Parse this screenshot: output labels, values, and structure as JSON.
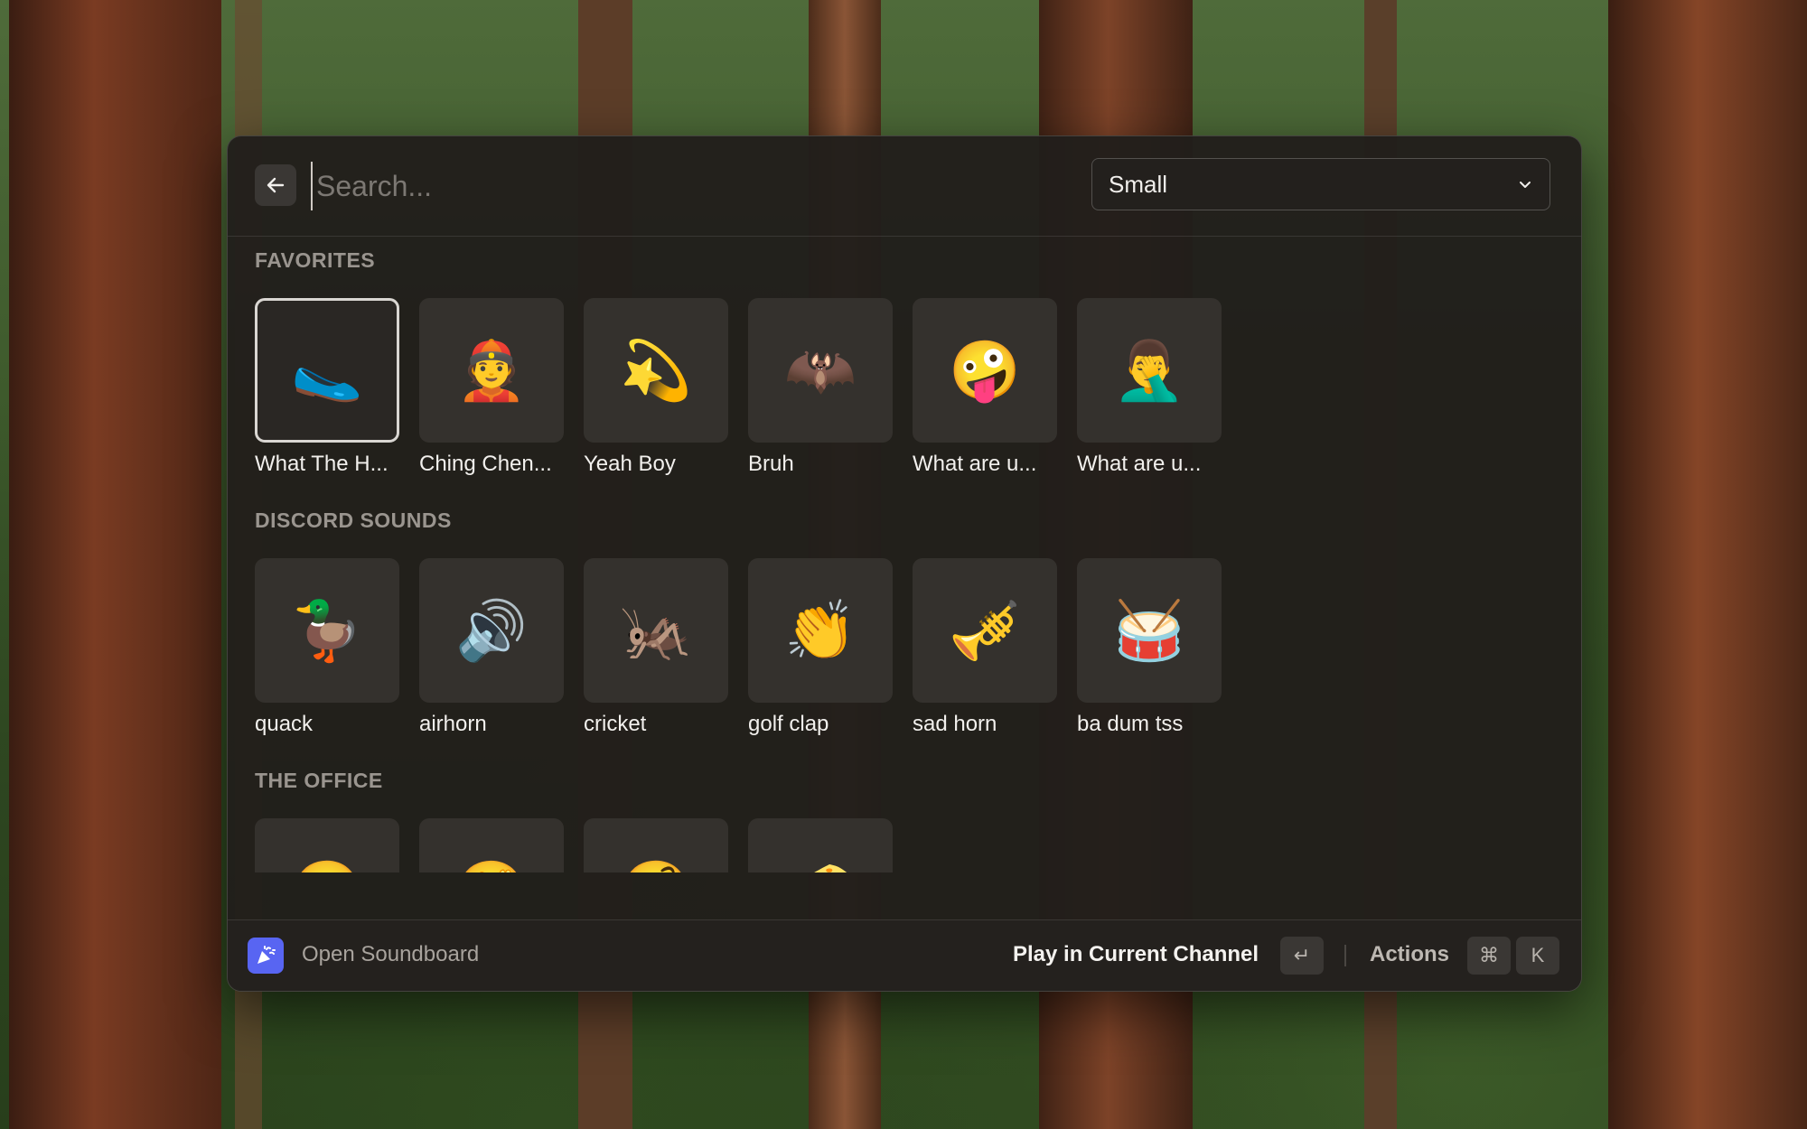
{
  "search": {
    "placeholder": "Search..."
  },
  "dropdown": {
    "value": "Small"
  },
  "sections": [
    {
      "title": "FAVORITES",
      "items": [
        {
          "label": "What The H...",
          "emoji": "🥿"
        },
        {
          "label": "Ching Chen...",
          "emoji": "👲"
        },
        {
          "label": "Yeah Boy",
          "emoji": "💫"
        },
        {
          "label": "Bruh",
          "emoji": "🦇"
        },
        {
          "label": "What are u...",
          "emoji": "🤪"
        },
        {
          "label": "What are u...",
          "emoji": "🤦‍♂️"
        }
      ]
    },
    {
      "title": "DISCORD SOUNDS",
      "items": [
        {
          "label": "quack",
          "emoji": "🦆"
        },
        {
          "label": "airhorn",
          "emoji": "🔊"
        },
        {
          "label": "cricket",
          "emoji": "🦗"
        },
        {
          "label": "golf clap",
          "emoji": "👏"
        },
        {
          "label": "sad horn",
          "emoji": "🎺"
        },
        {
          "label": "ba dum tss",
          "emoji": "🥁"
        }
      ]
    },
    {
      "title": "THE OFFICE",
      "items": [
        {
          "label": "",
          "emoji": "😖"
        },
        {
          "label": "",
          "emoji": "🫣"
        },
        {
          "label": "",
          "emoji": "🧐"
        },
        {
          "label": "",
          "emoji": "🧀"
        }
      ]
    }
  ],
  "footer": {
    "app_name": "Open Soundboard",
    "primary_action": "Play in Current Channel",
    "enter_key": "↵",
    "actions_label": "Actions",
    "cmd_key": "⌘",
    "k_key": "K"
  }
}
